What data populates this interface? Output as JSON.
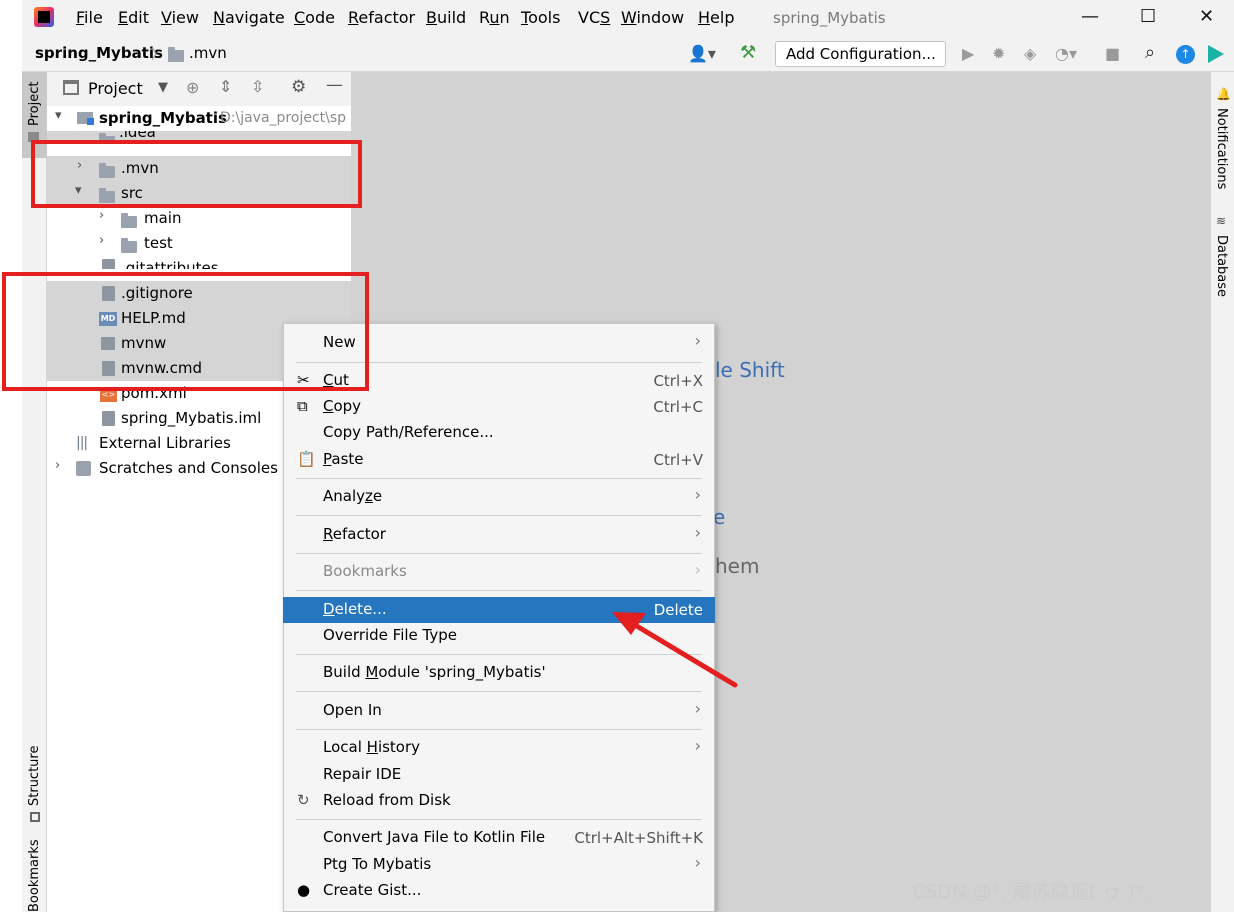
{
  "menubar": {
    "items": [
      {
        "pre": "",
        "u": "F",
        "post": "ile"
      },
      {
        "pre": "",
        "u": "E",
        "post": "dit"
      },
      {
        "pre": "",
        "u": "V",
        "post": "iew"
      },
      {
        "pre": "",
        "u": "N",
        "post": "avigate"
      },
      {
        "pre": "",
        "u": "C",
        "post": "ode"
      },
      {
        "pre": "",
        "u": "R",
        "post": "efactor"
      },
      {
        "pre": "",
        "u": "B",
        "post": "uild"
      },
      {
        "pre": "R",
        "u": "u",
        "post": "n"
      },
      {
        "pre": "",
        "u": "T",
        "post": "ools"
      },
      {
        "pre": "VC",
        "u": "S",
        "post": ""
      },
      {
        "pre": "",
        "u": "W",
        "post": "indow"
      },
      {
        "pre": "",
        "u": "H",
        "post": "elp"
      }
    ],
    "window_title": "spring_Mybatis",
    "minimize": "—",
    "maximize": "☐",
    "close": "✕"
  },
  "navbar": {
    "project": "spring_Mybatis",
    "sep": "〉",
    "folder": ".mvn",
    "add_configuration": "Add Configuration..."
  },
  "side": {
    "project_tab": "Project",
    "structure_tab": "Structure",
    "bookmarks_tab": "Bookmarks",
    "notifications_tab": "Notifications",
    "database_tab": "Database"
  },
  "panel": {
    "title": "Project",
    "tree": {
      "root": {
        "name": "spring_Mybatis",
        "path": "D:\\java_project\\sp"
      },
      "idea": ".idea",
      "mvn": ".mvn",
      "src": "src",
      "main": "main",
      "test": "test",
      "gitattributes": ".gitattributes",
      "gitignore": ".gitignore",
      "help": "HELP.md",
      "mvnw": "mvnw",
      "mvnwcmd": "mvnw.cmd",
      "pom": "pom.xml",
      "iml": "spring_Mybatis.iml",
      "extlib": "External Libraries",
      "scratches": "Scratches and Consoles"
    }
  },
  "editor": {
    "hint1": "le Shift",
    "hint2": "e",
    "hint3": "hem"
  },
  "context_menu": {
    "new": {
      "label": "New"
    },
    "cut": {
      "pre": "",
      "u": "C",
      "post": "ut",
      "shortcut": "Ctrl+X"
    },
    "copy": {
      "pre": "",
      "u": "C",
      "post": "opy",
      "shortcut": "Ctrl+C"
    },
    "copy_path": {
      "label": "Copy Path/Reference..."
    },
    "paste": {
      "pre": "",
      "u": "P",
      "post": "aste",
      "shortcut": "Ctrl+V"
    },
    "analyze": {
      "pre": "Analy",
      "u": "z",
      "post": "e"
    },
    "refactor": {
      "pre": "",
      "u": "R",
      "post": "efactor"
    },
    "bookmarks": {
      "label": "Bookmarks"
    },
    "delete": {
      "pre": "",
      "u": "D",
      "post": "elete...",
      "shortcut": "Delete"
    },
    "override": {
      "label": "Override File Type"
    },
    "build_module": {
      "pre": "Build ",
      "u": "M",
      "post": "odule 'spring_Mybatis'"
    },
    "open_in": {
      "label": "Open In"
    },
    "local_history": {
      "pre": "Local ",
      "u": "H",
      "post": "istory"
    },
    "repair": {
      "label": "Repair IDE"
    },
    "reload": {
      "label": "Reload from Disk"
    },
    "convert": {
      "label": "Convert Java File to Kotlin File",
      "shortcut": "Ctrl+Alt+Shift+K"
    },
    "ptg": {
      "label": "Ptg To Mybatis"
    },
    "gist": {
      "label": "Create Gist..."
    }
  },
  "watermark": "CSDN @*. 屠苏隐遥( ヮ )*.",
  "colors": {
    "accent": "#2675bf",
    "highlight_box": "#e3201f",
    "arrow": "#e3201f"
  }
}
